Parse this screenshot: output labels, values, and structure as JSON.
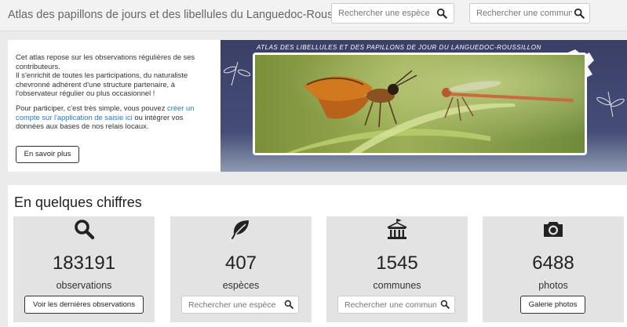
{
  "header": {
    "title": "Atlas des papillons de jours et des libellules du Languedoc-Roussillon",
    "search_species_placeholder": "Rechercher une espèce",
    "search_commune_placeholder": "Rechercher une commune"
  },
  "intro": {
    "p1": "Cet atlas repose sur les observations régulières de ses contributeurs.",
    "p2": "Il s'enrichit de toutes les participations, du naturaliste chevronné adhérent d'une structure partenaire, à l'observateur régulier ou plus occasionnel !",
    "p3_before": "Pour participer, c'est très simple, vous pouvez ",
    "p3_link": "créer un compte sur l'application de saisie ici",
    "p3_after": " ou intégrer vos données aux bases de nos relais locaux.",
    "more_button": "En savoir plus"
  },
  "banner": {
    "caption": "ATLAS DES LIBELLULES ET DES PAPILLONS DE JOUR DU LANGUEDOC-ROUSSILLON"
  },
  "stats": {
    "title": "En quelques chiffres",
    "cards": [
      {
        "icon": "search-icon",
        "value": "183191",
        "label": "observations",
        "action": "Voir les dernières observations"
      },
      {
        "icon": "leaf-icon",
        "value": "407",
        "label": "espèces",
        "placeholder": "Rechercher une espèce"
      },
      {
        "icon": "town-hall-icon",
        "value": "1545",
        "label": "communes",
        "placeholder": "Rechercher une commune"
      },
      {
        "icon": "camera-icon",
        "value": "6488",
        "label": "photos",
        "action": "Galerie photos"
      }
    ]
  },
  "colors": {
    "banner_bg": "#3d4468",
    "link": "#2a7ab8",
    "card_bg": "#e3e3e3"
  }
}
